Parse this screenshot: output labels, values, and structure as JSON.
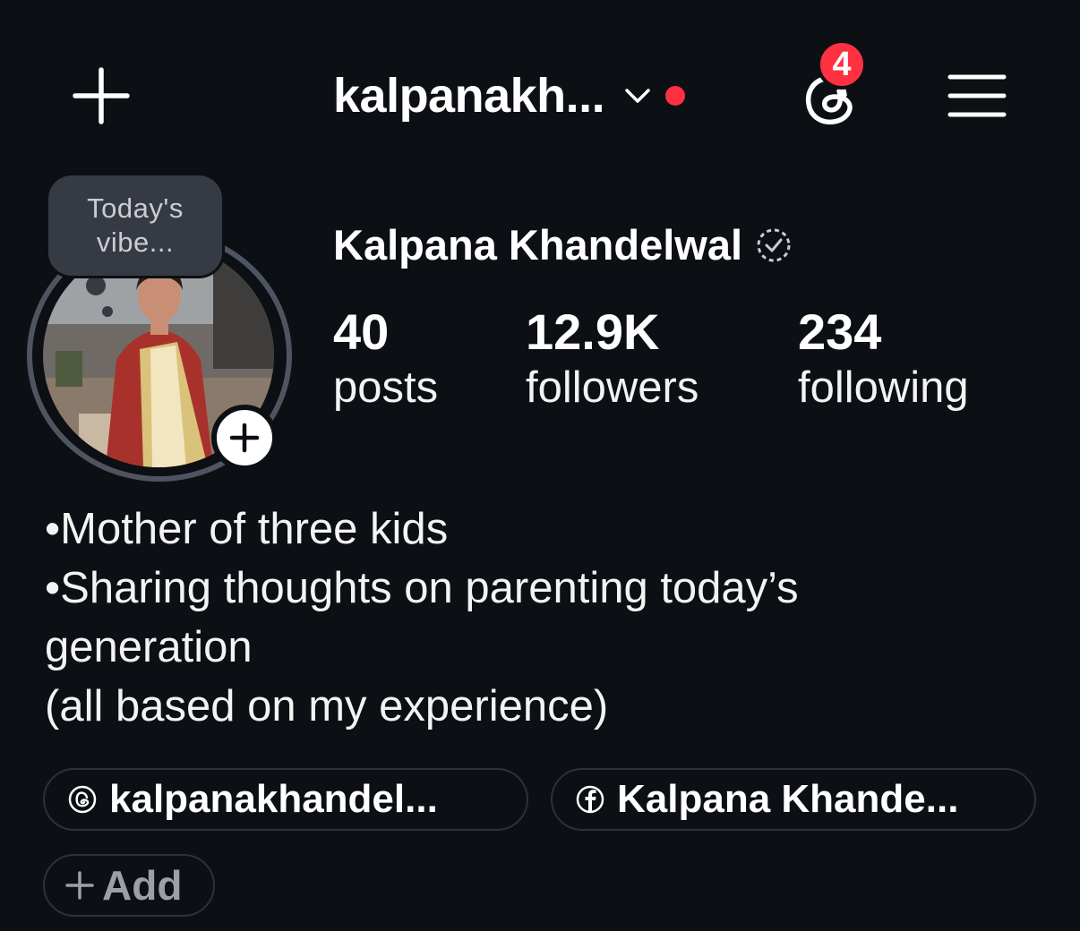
{
  "header": {
    "username": "kalpanakh...",
    "threads_badge_count": "4",
    "accent_red": "#ff3040"
  },
  "note": {
    "line1": "Today's",
    "line2": "vibe..."
  },
  "profile": {
    "display_name": "Kalpana Khandelwal",
    "stats": [
      {
        "value": "40",
        "label": "posts"
      },
      {
        "value": "12.9K",
        "label": "followers"
      },
      {
        "value": "234",
        "label": "following"
      }
    ]
  },
  "bio": {
    "lines": [
      "•Mother of three kids",
      "•Sharing thoughts on parenting today’s",
      "generation",
      "(all based on my experience)"
    ]
  },
  "links": {
    "threads": {
      "icon": "threads-icon",
      "label": "kalpanakhandel..."
    },
    "facebook": {
      "icon": "facebook-icon",
      "label": "Kalpana Khande..."
    },
    "add": {
      "icon": "plus-icon",
      "label": "Add"
    }
  }
}
